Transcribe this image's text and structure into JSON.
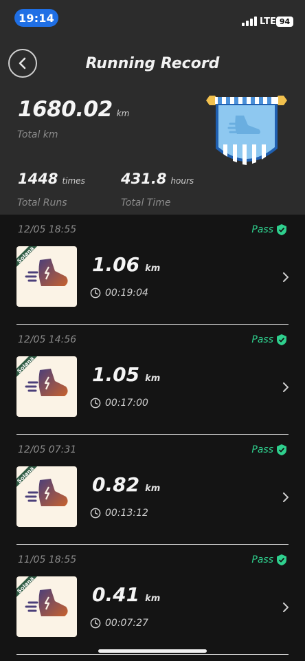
{
  "status_bar": {
    "time": "19:14",
    "network": "LTE",
    "battery": "94"
  },
  "header": {
    "title": "Running Record"
  },
  "summary": {
    "total_km": {
      "value": "1680.02",
      "unit": "km",
      "label": "Total km"
    },
    "total_runs": {
      "value": "1448",
      "unit": "times",
      "label": "Total Runs"
    },
    "total_time": {
      "value": "431.8",
      "unit": "hours",
      "label": "Total Time"
    }
  },
  "records": [
    {
      "date": "12/05 18:55",
      "status": "Pass",
      "distance": "1.06",
      "unit": "km",
      "duration": "00:19:04",
      "tag": "Solana"
    },
    {
      "date": "12/05 14:56",
      "status": "Pass",
      "distance": "1.05",
      "unit": "km",
      "duration": "00:17:00",
      "tag": "Solana"
    },
    {
      "date": "12/05 07:31",
      "status": "Pass",
      "distance": "0.82",
      "unit": "km",
      "duration": "00:13:12",
      "tag": "Solana"
    },
    {
      "date": "11/05 18:55",
      "status": "Pass",
      "distance": "0.41",
      "unit": "km",
      "duration": "00:07:27",
      "tag": "Solana"
    }
  ],
  "colors": {
    "pass": "#2fd08e",
    "accent_blue": "#1f6fe5",
    "header_bg": "#2c2c2c",
    "list_bg": "#141414"
  }
}
